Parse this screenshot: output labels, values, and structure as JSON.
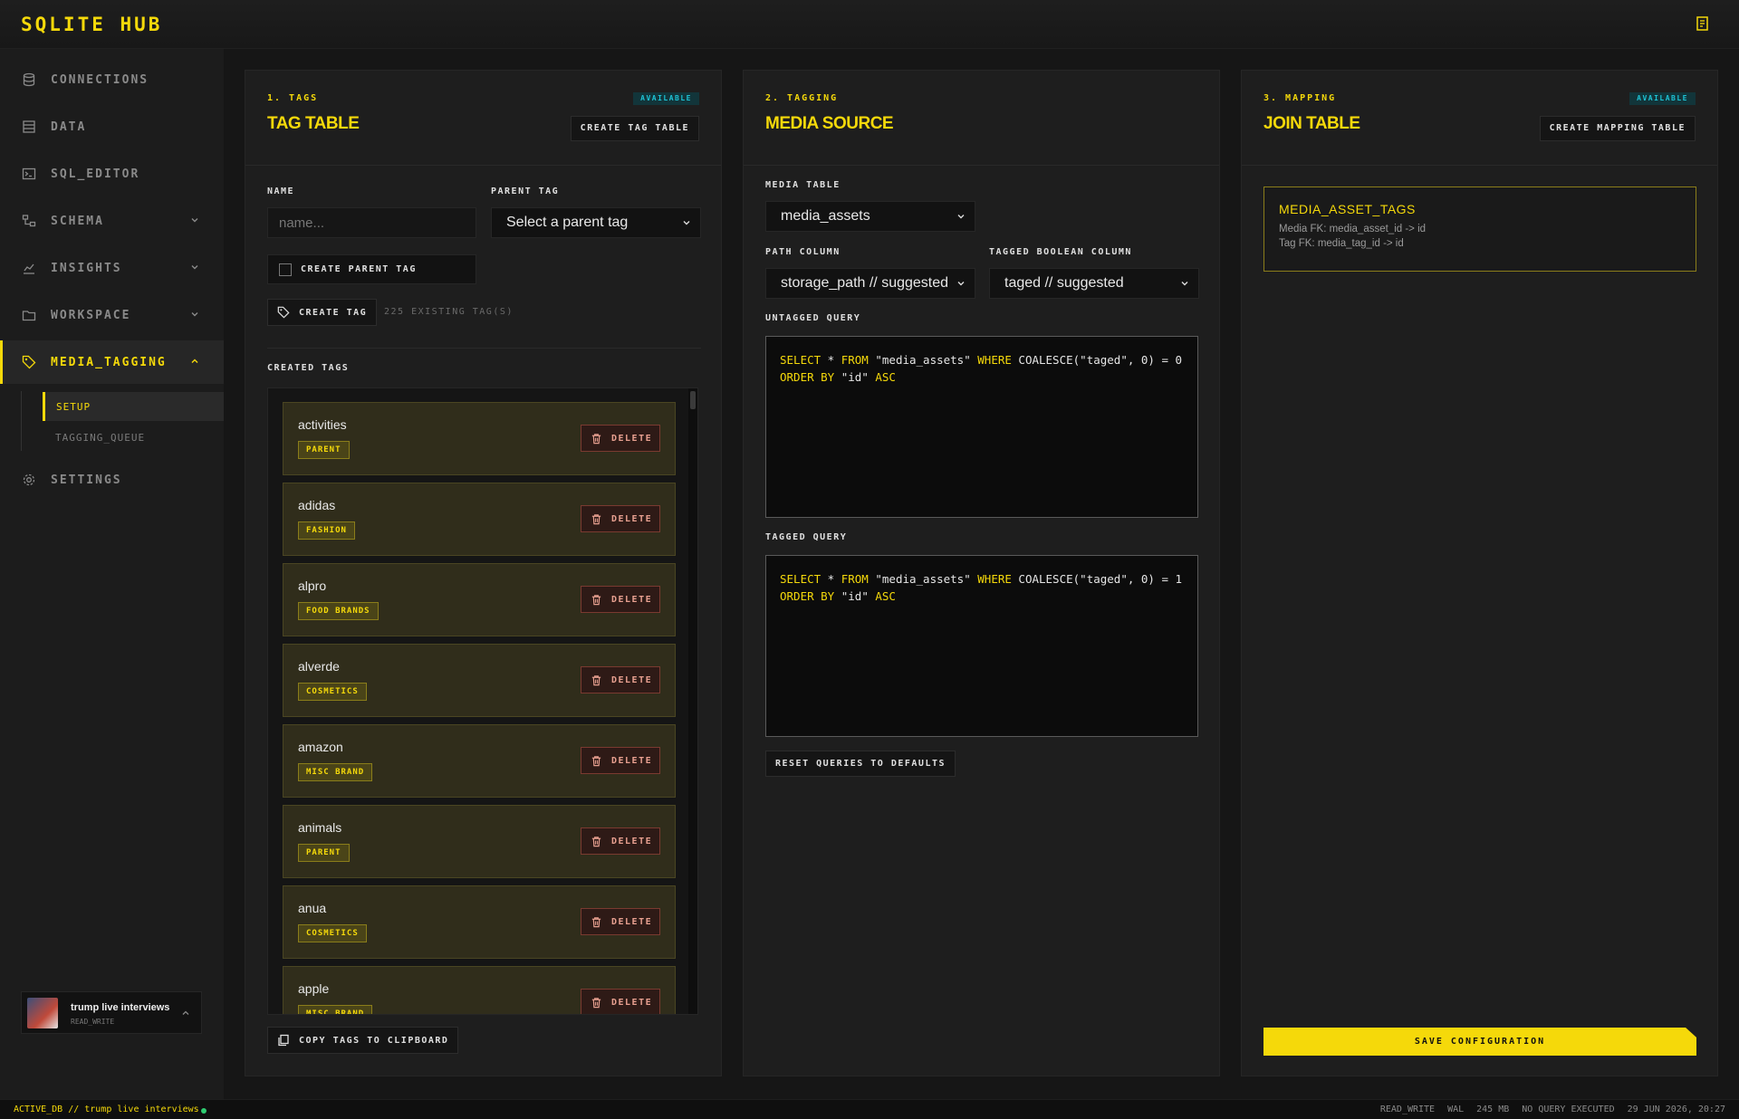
{
  "app": {
    "brand": "SQLITE HUB",
    "accent": "#f5d90a"
  },
  "sidebar": {
    "items": [
      {
        "label": "CONNECTIONS",
        "icon": "database-icon"
      },
      {
        "label": "DATA",
        "icon": "table-icon"
      },
      {
        "label": "SQL_EDITOR",
        "icon": "terminal-icon"
      },
      {
        "label": "SCHEMA",
        "icon": "schema-icon"
      },
      {
        "label": "INSIGHTS",
        "icon": "chart-icon"
      },
      {
        "label": "WORKSPACE",
        "icon": "folder-icon"
      },
      {
        "label": "MEDIA_TAGGING",
        "icon": "tag-icon"
      },
      {
        "label": "SETTINGS",
        "icon": "gear-icon"
      }
    ],
    "sub_items": [
      "SETUP",
      "TAGGING_QUEUE"
    ],
    "db_card": {
      "name": "trump live interviews",
      "mode": "READ_WRITE"
    }
  },
  "tags_panel": {
    "step": "1. TAGS",
    "title": "TAG TABLE",
    "badge": "AVAILABLE",
    "action": "CREATE TAG TABLE",
    "name_label": "NAME",
    "name_placeholder": "name...",
    "parent_label": "PARENT TAG",
    "parent_value": "Select a parent tag",
    "create_parent_label": "CREATE PARENT TAG",
    "create_tag_label": "CREATE TAG",
    "existing_count": "225 EXISTING TAG(S)",
    "created_label": "CREATED TAGS",
    "delete_label": "DELETE",
    "tags": [
      {
        "name": "activities",
        "group": "PARENT"
      },
      {
        "name": "adidas",
        "group": "FASHION"
      },
      {
        "name": "alpro",
        "group": "FOOD BRANDS"
      },
      {
        "name": "alverde",
        "group": "COSMETICS"
      },
      {
        "name": "amazon",
        "group": "MISC BRAND"
      },
      {
        "name": "animals",
        "group": "PARENT"
      },
      {
        "name": "anua",
        "group": "COSMETICS"
      },
      {
        "name": "apple",
        "group": "MISC BRAND"
      }
    ],
    "copy_label": "COPY TAGS TO CLIPBOARD"
  },
  "tagging_panel": {
    "step": "2. TAGGING",
    "title": "MEDIA SOURCE",
    "media_table_label": "MEDIA TABLE",
    "media_table_value": "media_assets",
    "path_label": "PATH COLUMN",
    "path_value": "storage_path // suggested",
    "bool_label": "TAGGED BOOLEAN COLUMN",
    "bool_value": "taged // suggested",
    "untagged_label": "UNTAGGED QUERY",
    "tagged_label": "TAGGED QUERY",
    "untagged_query": {
      "l1": [
        "SELECT",
        " * ",
        "FROM",
        " \"media_assets\" ",
        "WHERE",
        " COALESCE(\"taged\", 0) = 0"
      ],
      "l2": [
        "ORDER BY",
        " \"id\" ",
        "ASC"
      ]
    },
    "tagged_query": {
      "l1": [
        "SELECT",
        " * ",
        "FROM",
        " \"media_assets\" ",
        "WHERE",
        " COALESCE(\"taged\", 0) = 1"
      ],
      "l2": [
        "ORDER BY",
        " \"id\" ",
        "ASC"
      ]
    },
    "reset_label": "RESET QUERIES TO DEFAULTS"
  },
  "mapping_panel": {
    "step": "3. MAPPING",
    "title": "JOIN TABLE",
    "badge": "AVAILABLE",
    "action": "CREATE MAPPING TABLE",
    "join_name": "MEDIA_ASSET_TAGS",
    "media_fk": "Media FK: media_asset_id -> id",
    "tag_fk": "Tag FK: media_tag_id -> id",
    "save_label": "SAVE CONFIGURATION"
  },
  "status": {
    "active_db": "ACTIVE_DB // trump live interviews",
    "mode": "READ_WRITE",
    "journal": "WAL",
    "size": "245 MB",
    "query": "NO QUERY EXECUTED",
    "timestamp": "29 JUN 2026, 20:27"
  }
}
